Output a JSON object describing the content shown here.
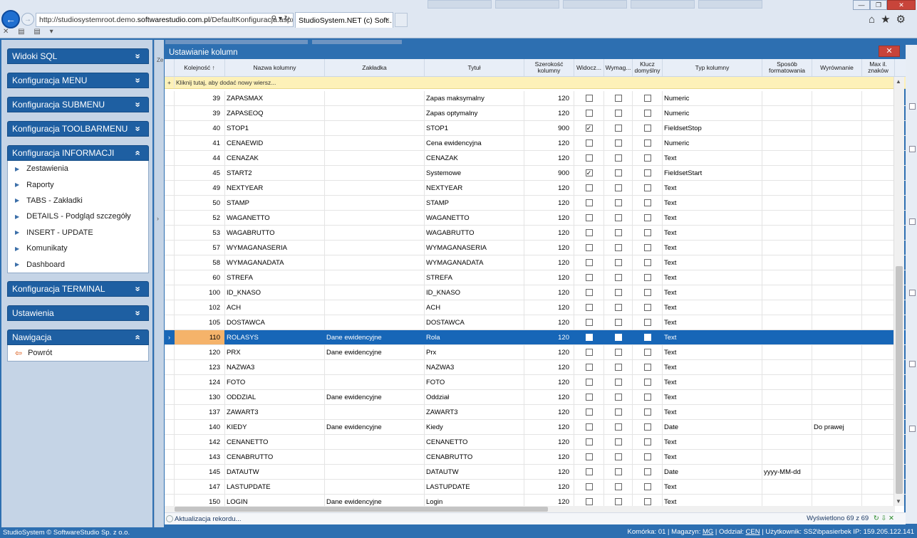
{
  "browser": {
    "url_prefix": "http://studiosystemroot.demo.",
    "url_domain": "softwarestudio.com.pl",
    "url_path": "/DefaultKonfiguracja.aspx",
    "url_actions": "⚲ ▾ ↻",
    "tab_title": "StudioSystem.NET (c) Soft...",
    "tab_close": "×",
    "window_controls": {
      "minimize": "—",
      "maximize": "❐",
      "close": "✕"
    },
    "toolbar_icons": "⌂★⚙",
    "favorites_icons": "✕ ▤ ▤ ▾"
  },
  "sidebar": {
    "sections": [
      {
        "title": "Widoki SQL",
        "icon": "chevron-double-down",
        "glyph": "»",
        "expanded": false
      },
      {
        "title": "Konfiguracja MENU",
        "icon": "chevron-double-down",
        "glyph": "»",
        "expanded": false
      },
      {
        "title": "Konfiguracja SUBMENU",
        "icon": "chevron-double-down",
        "glyph": "»",
        "expanded": false
      },
      {
        "title": "Konfiguracja TOOLBARMENU",
        "icon": "chevron-double-down",
        "glyph": "»",
        "expanded": false
      },
      {
        "title": "Konfiguracja INFORMACJI",
        "icon": "chevron-double-up",
        "glyph": "«",
        "expanded": true,
        "items": [
          "Zestawienia",
          "Raporty",
          "TABS - Zakładki",
          "DETAILS - Podgląd szczegóły",
          "INSERT - UPDATE",
          "Komunikaty",
          "Dashboard"
        ]
      },
      {
        "title": "Konfiguracja TERMINAL",
        "icon": "chevron-double-down",
        "glyph": "»",
        "expanded": false
      },
      {
        "title": "Ustawienia",
        "icon": "chevron-double-down",
        "glyph": "»",
        "expanded": false
      },
      {
        "title": "Nawigacja",
        "icon": "chevron-double-up",
        "glyph": "«",
        "expanded": true,
        "items": [
          "Powrót"
        ]
      }
    ],
    "item_bullet": "▶",
    "back_arrow": "⇦"
  },
  "dialog": {
    "title": "Ustawianie kolumn",
    "close_label": "✕",
    "add_row_label": "Kliknij tutaj, aby dodać nowy wiersz...",
    "columns": [
      "Kolejność ↑",
      "Nazwa kolumny",
      "Zakładka",
      "Tytuł",
      "Szerokość kolumny",
      "Widocz...",
      "Wymag...",
      "Klucz domyślny",
      "Typ kolumny",
      "Sposób formatowania",
      "Wyrównanie",
      "Max il. znaków"
    ],
    "rows": [
      {
        "order": "39",
        "name": "ZAPASMAX",
        "tab": "",
        "title": "Zapas maksymalny",
        "width": "120",
        "visible": false,
        "required": false,
        "key": false,
        "type": "Numeric",
        "format": "",
        "align": ""
      },
      {
        "order": "39",
        "name": "ZAPASEOQ",
        "tab": "",
        "title": "Zapas optymalny",
        "width": "120",
        "visible": false,
        "required": false,
        "key": false,
        "type": "Numeric",
        "format": "",
        "align": ""
      },
      {
        "order": "40",
        "name": "STOP1",
        "tab": "",
        "title": "STOP1",
        "width": "900",
        "visible": true,
        "required": false,
        "key": false,
        "type": "FieldsetStop",
        "format": "",
        "align": ""
      },
      {
        "order": "41",
        "name": "CENAEWID",
        "tab": "",
        "title": "Cena ewidencyjna",
        "width": "120",
        "visible": false,
        "required": false,
        "key": false,
        "type": "Numeric",
        "format": "",
        "align": ""
      },
      {
        "order": "44",
        "name": "CENAZAK",
        "tab": "",
        "title": "CENAZAK",
        "width": "120",
        "visible": false,
        "required": false,
        "key": false,
        "type": "Text",
        "format": "",
        "align": ""
      },
      {
        "order": "45",
        "name": "START2",
        "tab": "",
        "title": "Systemowe",
        "width": "900",
        "visible": true,
        "required": false,
        "key": false,
        "type": "FieldsetStart",
        "format": "",
        "align": ""
      },
      {
        "order": "49",
        "name": "NEXTYEAR",
        "tab": "",
        "title": "NEXTYEAR",
        "width": "120",
        "visible": false,
        "required": false,
        "key": false,
        "type": "Text",
        "format": "",
        "align": ""
      },
      {
        "order": "50",
        "name": "STAMP",
        "tab": "",
        "title": "STAMP",
        "width": "120",
        "visible": false,
        "required": false,
        "key": false,
        "type": "Text",
        "format": "",
        "align": ""
      },
      {
        "order": "52",
        "name": "WAGANETTO",
        "tab": "",
        "title": "WAGANETTO",
        "width": "120",
        "visible": false,
        "required": false,
        "key": false,
        "type": "Text",
        "format": "",
        "align": ""
      },
      {
        "order": "53",
        "name": "WAGABRUTTO",
        "tab": "",
        "title": "WAGABRUTTO",
        "width": "120",
        "visible": false,
        "required": false,
        "key": false,
        "type": "Text",
        "format": "",
        "align": ""
      },
      {
        "order": "57",
        "name": "WYMAGANASERIA",
        "tab": "",
        "title": "WYMAGANASERIA",
        "width": "120",
        "visible": false,
        "required": false,
        "key": false,
        "type": "Text",
        "format": "",
        "align": ""
      },
      {
        "order": "58",
        "name": "WYMAGANADATA",
        "tab": "",
        "title": "WYMAGANADATA",
        "width": "120",
        "visible": false,
        "required": false,
        "key": false,
        "type": "Text",
        "format": "",
        "align": ""
      },
      {
        "order": "60",
        "name": "STREFA",
        "tab": "",
        "title": "STREFA",
        "width": "120",
        "visible": false,
        "required": false,
        "key": false,
        "type": "Text",
        "format": "",
        "align": ""
      },
      {
        "order": "100",
        "name": "ID_KNASO",
        "tab": "",
        "title": "ID_KNASO",
        "width": "120",
        "visible": false,
        "required": false,
        "key": false,
        "type": "Text",
        "format": "",
        "align": ""
      },
      {
        "order": "102",
        "name": "ACH",
        "tab": "",
        "title": "ACH",
        "width": "120",
        "visible": false,
        "required": false,
        "key": false,
        "type": "Text",
        "format": "",
        "align": ""
      },
      {
        "order": "105",
        "name": "DOSTAWCA",
        "tab": "",
        "title": "DOSTAWCA",
        "width": "120",
        "visible": false,
        "required": false,
        "key": false,
        "type": "Text",
        "format": "",
        "align": ""
      },
      {
        "order": "110",
        "name": "ROLASYS",
        "tab": "Dane ewidencyjne",
        "title": "Rola",
        "width": "120",
        "visible": false,
        "required": false,
        "key": false,
        "type": "Text",
        "format": "",
        "align": "",
        "selected": true
      },
      {
        "order": "120",
        "name": "PRX",
        "tab": "Dane ewidencyjne",
        "title": "Prx",
        "width": "120",
        "visible": false,
        "required": false,
        "key": false,
        "type": "Text",
        "format": "",
        "align": ""
      },
      {
        "order": "123",
        "name": "NAZWA3",
        "tab": "",
        "title": "NAZWA3",
        "width": "120",
        "visible": false,
        "required": false,
        "key": false,
        "type": "Text",
        "format": "",
        "align": ""
      },
      {
        "order": "124",
        "name": "FOTO",
        "tab": "",
        "title": "FOTO",
        "width": "120",
        "visible": false,
        "required": false,
        "key": false,
        "type": "Text",
        "format": "",
        "align": ""
      },
      {
        "order": "130",
        "name": "ODDZIAL",
        "tab": "Dane ewidencyjne",
        "title": "Oddział",
        "width": "120",
        "visible": false,
        "required": false,
        "key": false,
        "type": "Text",
        "format": "",
        "align": ""
      },
      {
        "order": "137",
        "name": "ZAWART3",
        "tab": "",
        "title": "ZAWART3",
        "width": "120",
        "visible": false,
        "required": false,
        "key": false,
        "type": "Text",
        "format": "",
        "align": ""
      },
      {
        "order": "140",
        "name": "KIEDY",
        "tab": "Dane ewidencyjne",
        "title": "Kiedy",
        "width": "120",
        "visible": false,
        "required": false,
        "key": false,
        "type": "Date",
        "format": "",
        "align": "Do prawej"
      },
      {
        "order": "142",
        "name": "CENANETTO",
        "tab": "",
        "title": "CENANETTO",
        "width": "120",
        "visible": false,
        "required": false,
        "key": false,
        "type": "Text",
        "format": "",
        "align": ""
      },
      {
        "order": "143",
        "name": "CENABRUTTO",
        "tab": "",
        "title": "CENABRUTTO",
        "width": "120",
        "visible": false,
        "required": false,
        "key": false,
        "type": "Text",
        "format": "",
        "align": ""
      },
      {
        "order": "145",
        "name": "DATAUTW",
        "tab": "",
        "title": "DATAUTW",
        "width": "120",
        "visible": false,
        "required": false,
        "key": false,
        "type": "Date",
        "format": "yyyy-MM-dd",
        "align": ""
      },
      {
        "order": "147",
        "name": "LASTUPDATE",
        "tab": "",
        "title": "LASTUPDATE",
        "width": "120",
        "visible": false,
        "required": false,
        "key": false,
        "type": "Text",
        "format": "",
        "align": ""
      },
      {
        "order": "150",
        "name": "LOGIN",
        "tab": "Dane ewidencyjne",
        "title": "Login",
        "width": "120",
        "visible": false,
        "required": false,
        "key": false,
        "type": "Text",
        "format": "",
        "align": ""
      }
    ],
    "status_left": "Aktualizacja rekordu...",
    "status_right": "Wyświetlono 69 z 69",
    "status_icons": "↻ ⇩ ✕"
  },
  "footer": {
    "copyright": "StudioSystem © SoftwareStudio Sp. z o.o.",
    "komorka_label": "Komórka:",
    "komorka": "01",
    "magazyn_label": "Magazyn:",
    "magazyn": "MG",
    "oddzial_label": "Oddział:",
    "oddzial": "CEN",
    "uzytkownik_label": "Użytkownik:",
    "uzytkownik": "SS2\\bpasierbek",
    "ip_label": "IP:",
    "ip": "159.205.122.141"
  },
  "colors": {
    "accent": "#2d6fb1",
    "header_blue": "#1e5fa2",
    "selected_row": "#1766b7",
    "selected_order_cell": "#f5b36a",
    "new_row_bg": "#fdf1b8"
  }
}
